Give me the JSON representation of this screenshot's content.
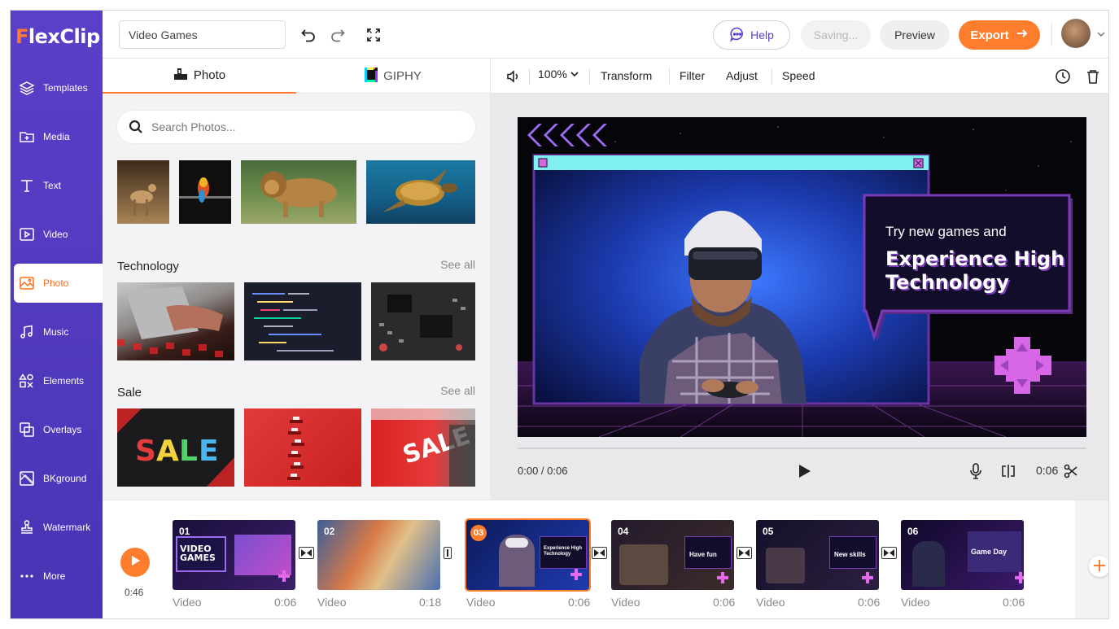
{
  "app": {
    "logo_f": "F",
    "logo_rest": "lexClip"
  },
  "sidebar": {
    "items": [
      {
        "label": "Templates",
        "icon": "layers-icon"
      },
      {
        "label": "Media",
        "icon": "folder-plus-icon"
      },
      {
        "label": "Text",
        "icon": "text-icon"
      },
      {
        "label": "Video",
        "icon": "video-icon"
      },
      {
        "label": "Photo",
        "icon": "image-icon",
        "active": true
      },
      {
        "label": "Music",
        "icon": "music-icon"
      },
      {
        "label": "Elements",
        "icon": "shapes-icon"
      },
      {
        "label": "Overlays",
        "icon": "overlay-icon"
      },
      {
        "label": "BKground",
        "icon": "background-icon"
      },
      {
        "label": "Watermark",
        "icon": "stamp-icon"
      },
      {
        "label": "More",
        "icon": "more-dots-icon"
      }
    ]
  },
  "header": {
    "project_title": "Video Games",
    "help": "Help",
    "saving": "Saving...",
    "preview": "Preview",
    "export": "Export"
  },
  "panel": {
    "tabs": [
      {
        "label": "Photo"
      },
      {
        "label": "GIPHY"
      }
    ],
    "search_placeholder": "Search Photos...",
    "sections": [
      {
        "title": "Technology",
        "see_all": "See all"
      },
      {
        "title": "Sale",
        "see_all": "See all"
      }
    ]
  },
  "toolbar": {
    "zoom": "100%",
    "transform": "Transform",
    "filter": "Filter",
    "adjust": "Adjust",
    "speed": "Speed"
  },
  "stage": {
    "headline_small": "Try new games and",
    "headline_line1": "Experience High",
    "headline_line2": "Technology"
  },
  "player": {
    "time": "0:00 / 0:06",
    "duration": "0:06"
  },
  "timeline": {
    "total": "0:46",
    "clips": [
      {
        "num": "01",
        "label": "Video",
        "duration": "0:06",
        "overlay": "VIDEO GAMES"
      },
      {
        "num": "02",
        "label": "Video",
        "duration": "0:18",
        "overlay": ""
      },
      {
        "num": "03",
        "label": "Video",
        "duration": "0:06",
        "overlay": "Experience High Technology",
        "selected": true
      },
      {
        "num": "04",
        "label": "Video",
        "duration": "0:06",
        "overlay": "Have fun"
      },
      {
        "num": "05",
        "label": "Video",
        "duration": "0:06",
        "overlay": "New skills"
      },
      {
        "num": "06",
        "label": "Video",
        "duration": "0:06",
        "overlay": "Game Day"
      }
    ]
  },
  "colors": {
    "accent": "#ff7e2e",
    "sidebar": "#5a3fc9",
    "help": "#5b3fd1"
  }
}
